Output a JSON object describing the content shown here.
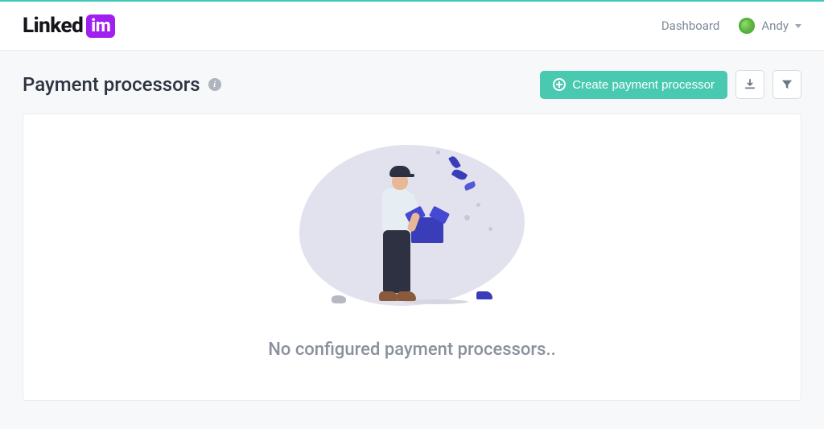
{
  "brand": {
    "text_part1": "Linked",
    "text_part2": "im"
  },
  "nav": {
    "dashboard_label": "Dashboard",
    "user_name": "Andy"
  },
  "page": {
    "title": "Payment processors",
    "create_button_label": "Create payment processor",
    "empty_message": "No configured payment processors.."
  },
  "colors": {
    "accent": "#48c9b0",
    "brand_badge": "#a020f0"
  }
}
